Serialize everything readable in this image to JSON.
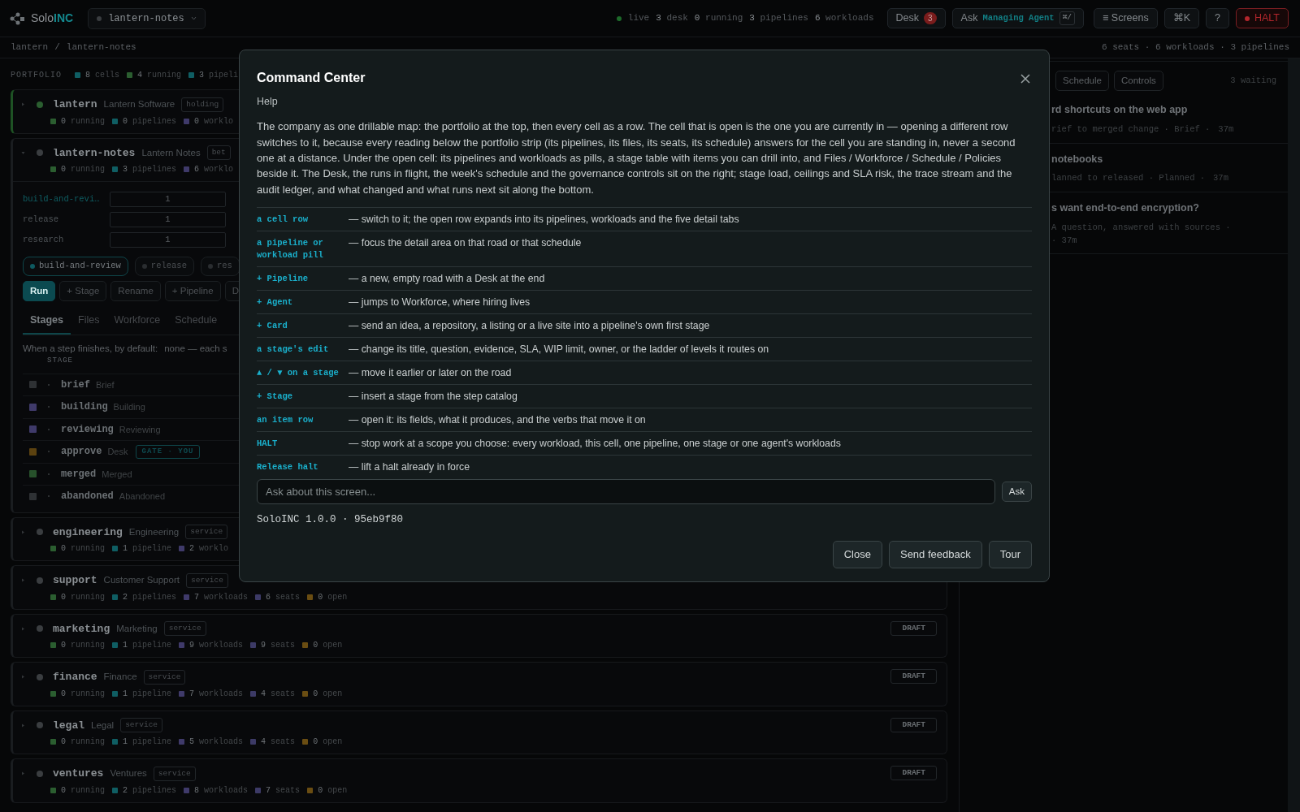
{
  "topbar": {
    "brand": {
      "name": "Solo",
      "accent": "INC"
    },
    "cell_picker": "lantern-notes",
    "live": "live",
    "counts": [
      {
        "count": "3",
        "label": "desk"
      },
      {
        "count": "0",
        "label": "running"
      },
      {
        "count": "3",
        "label": "pipelines"
      },
      {
        "count": "6",
        "label": "workloads"
      }
    ],
    "desk": {
      "label": "Desk",
      "badge": "3"
    },
    "ask": {
      "label": "Ask",
      "agent": "Managing Agent",
      "shortcut": "⌘/"
    },
    "screens": {
      "glyph": "≡",
      "label": "Screens"
    },
    "palette": "⌘K",
    "help": "?",
    "halt": "HALT"
  },
  "breadcrumb": {
    "items": [
      "lantern",
      "lantern-notes"
    ],
    "separator": "/",
    "summary": "6 seats · 6 workloads · 3 pipelines"
  },
  "portfolio": {
    "label": "PORTFOLIO",
    "stats": [
      {
        "count": "8",
        "label": "cells",
        "color": "#0f5e63"
      },
      {
        "count": "4",
        "label": "running",
        "color": "#2b5e30"
      },
      {
        "count": "3",
        "label": "pipeli",
        "color": "#0f5e63"
      }
    ]
  },
  "cells": [
    {
      "name": "lantern",
      "title": "Lantern Software",
      "tag": "holding",
      "color": "#2b5e30",
      "selected": true,
      "expanded": false,
      "stats": [
        {
          "count": "0",
          "label": "running",
          "color": "#2b5e30"
        },
        {
          "count": "0",
          "label": "pipelines",
          "color": "#0f5e63"
        },
        {
          "count": "0",
          "label": "worklo",
          "color": "#3f3a6a"
        }
      ]
    },
    {
      "name": "lantern-notes",
      "title": "Lantern Notes",
      "tag": "bet",
      "color": "#3a3d40",
      "selected": false,
      "expanded": true,
      "stats": [
        {
          "count": "0",
          "label": "running",
          "color": "#2b5e30"
        },
        {
          "count": "3",
          "label": "pipelines",
          "color": "#0f5e63"
        },
        {
          "count": "6",
          "label": "worklo",
          "color": "#3f3a6a"
        }
      ]
    },
    {
      "name": "engineering",
      "title": "Engineering",
      "tag": "service",
      "color": "#3a3d40",
      "selected": false,
      "expanded": false,
      "stats": [
        {
          "count": "0",
          "label": "running",
          "color": "#2b5e30"
        },
        {
          "count": "1",
          "label": "pipeline",
          "color": "#0f5e63"
        },
        {
          "count": "2",
          "label": "worklo",
          "color": "#3f3a6a"
        }
      ]
    },
    {
      "name": "support",
      "title": "Customer Support",
      "tag": "service",
      "color": "#3a3d40",
      "selected": false,
      "expanded": false,
      "stats": [
        {
          "count": "0",
          "label": "running",
          "color": "#2b5e30"
        },
        {
          "count": "2",
          "label": "pipelines",
          "color": "#0f5e63"
        },
        {
          "count": "7",
          "label": "workloads",
          "color": "#3f3a6a"
        },
        {
          "count": "6",
          "label": "seats",
          "color": "#3c3a66"
        },
        {
          "count": "0",
          "label": "open",
          "color": "#6a4d12"
        }
      ]
    },
    {
      "name": "marketing",
      "title": "Marketing",
      "tag": "service",
      "color": "#3a3d40",
      "selected": false,
      "expanded": false,
      "draft": "DRAFT",
      "stats": [
        {
          "count": "0",
          "label": "running",
          "color": "#2b5e30"
        },
        {
          "count": "1",
          "label": "pipeline",
          "color": "#0f5e63"
        },
        {
          "count": "9",
          "label": "workloads",
          "color": "#3f3a6a"
        },
        {
          "count": "9",
          "label": "seats",
          "color": "#3c3a66"
        },
        {
          "count": "0",
          "label": "open",
          "color": "#6a4d12"
        }
      ]
    },
    {
      "name": "finance",
      "title": "Finance",
      "tag": "service",
      "color": "#3a3d40",
      "selected": false,
      "expanded": false,
      "draft": "DRAFT",
      "stats": [
        {
          "count": "0",
          "label": "running",
          "color": "#2b5e30"
        },
        {
          "count": "1",
          "label": "pipeline",
          "color": "#0f5e63"
        },
        {
          "count": "7",
          "label": "workloads",
          "color": "#3f3a6a"
        },
        {
          "count": "4",
          "label": "seats",
          "color": "#3c3a66"
        },
        {
          "count": "0",
          "label": "open",
          "color": "#6a4d12"
        }
      ]
    },
    {
      "name": "legal",
      "title": "Legal",
      "tag": "service",
      "color": "#3a3d40",
      "selected": false,
      "expanded": false,
      "draft": "DRAFT",
      "stats": [
        {
          "count": "0",
          "label": "running",
          "color": "#2b5e30"
        },
        {
          "count": "1",
          "label": "pipeline",
          "color": "#0f5e63"
        },
        {
          "count": "5",
          "label": "workloads",
          "color": "#3f3a6a"
        },
        {
          "count": "4",
          "label": "seats",
          "color": "#3c3a66"
        },
        {
          "count": "0",
          "label": "open",
          "color": "#6a4d12"
        }
      ]
    },
    {
      "name": "ventures",
      "title": "Ventures",
      "tag": "service",
      "color": "#3a3d40",
      "selected": false,
      "expanded": false,
      "draft": "DRAFT",
      "stats": [
        {
          "count": "0",
          "label": "running",
          "color": "#2b5e30"
        },
        {
          "count": "2",
          "label": "pipelines",
          "color": "#0f5e63"
        },
        {
          "count": "8",
          "label": "workloads",
          "color": "#3f3a6a"
        },
        {
          "count": "7",
          "label": "seats",
          "color": "#3c3a66"
        },
        {
          "count": "0",
          "label": "open",
          "color": "#6a4d12"
        }
      ]
    }
  ],
  "open_cell": {
    "pipelines": [
      {
        "name": "build-and-revi…",
        "value": "1",
        "selected": true
      },
      {
        "name": "release",
        "value": "1",
        "selected": false
      },
      {
        "name": "research",
        "value": "1",
        "selected": false
      }
    ],
    "pills": [
      {
        "label": "build-and-review",
        "selected": true
      },
      {
        "label": "release",
        "selected": false
      },
      {
        "label": "res",
        "selected": false
      }
    ],
    "actions": [
      {
        "label": "Run",
        "kind": "primary"
      },
      {
        "label": "+ Stage",
        "kind": "outline"
      },
      {
        "label": "Rename",
        "kind": "outline"
      },
      {
        "label": "+ Pipeline",
        "kind": "outline"
      },
      {
        "label": "D",
        "kind": "outline"
      }
    ],
    "tabs": [
      {
        "label": "Stages",
        "selected": true
      },
      {
        "label": "Files",
        "selected": false
      },
      {
        "label": "Workforce",
        "selected": false
      },
      {
        "label": "Schedule",
        "selected": false
      }
    ],
    "note": {
      "label": "When a step finishes, by default:",
      "value": "none — each s"
    },
    "stage_header": "STAGE",
    "stages": [
      {
        "name": "brief",
        "label": "Brief",
        "color": "#2e3134"
      },
      {
        "name": "building",
        "label": "Building",
        "color": "#3f3a6a"
      },
      {
        "name": "reviewing",
        "label": "Reviewing",
        "color": "#3f3a6a"
      },
      {
        "name": "approve",
        "label": "Desk",
        "color": "#5c4210",
        "badge": "GATE · YOU"
      },
      {
        "name": "merged",
        "label": "Merged",
        "color": "#27512b"
      },
      {
        "name": "abandoned",
        "label": "Abandoned",
        "color": "#2e3134"
      }
    ]
  },
  "side": {
    "tabs": [
      {
        "label": "Schedule",
        "selected": false
      },
      {
        "label": "Controls",
        "selected": false
      }
    ],
    "waiting": "3 waiting",
    "items": [
      {
        "title": "rd shortcuts on the web app",
        "meta": "rief to merged change · Brief ·",
        "time": "37m"
      },
      {
        "title": "notebooks",
        "meta": "lanned to released · Planned ·",
        "time": "37m"
      },
      {
        "title": "s want end-to-end encryption?",
        "meta": "A question, answered with sources ·",
        "time": "· 37m"
      }
    ]
  },
  "modal": {
    "title": "Command Center",
    "subtitle": "Help",
    "intro": "The company as one drillable map: the portfolio at the top, then every cell as a row. The cell that is open is the one you are currently in — opening a different row switches to it, because every reading below the portfolio strip (its pipelines, its files, its seats, its schedule) answers for the cell you are standing in, never a second one at a distance. Under the open cell: its pipelines and workloads as pills, a stage table with items you can drill into, and Files / Workforce / Schedule / Policies beside it. The Desk, the runs in flight, the week's schedule and the governance controls sit on the right; stage load, ceilings and SLA risk, the trace stream and the audit ledger, and what changed and what runs next sit along the bottom.",
    "rows": [
      {
        "key": "a cell row",
        "text": "— switch to it; the open row expands into its pipelines, workloads and the five detail tabs"
      },
      {
        "key": "a pipeline or workload pill",
        "text": "— focus the detail area on that road or that schedule"
      },
      {
        "key": "+ Pipeline",
        "text": "— a new, empty road with a Desk at the end"
      },
      {
        "key": "+ Agent",
        "text": "— jumps to Workforce, where hiring lives"
      },
      {
        "key": "+ Card",
        "text": "— send an idea, a repository, a listing or a live site into a pipeline's own first stage"
      },
      {
        "key": "a stage's edit",
        "text": "— change its title, question, evidence, SLA, WIP limit, owner, or the ladder of levels it routes on"
      },
      {
        "key": "▲ / ▼ on a stage",
        "text": "— move it earlier or later on the road"
      },
      {
        "key": "+ Stage",
        "text": "— insert a stage from the step catalog"
      },
      {
        "key": "an item row",
        "text": "— open it: its fields, what it produces, and the verbs that move it on"
      },
      {
        "key": "HALT",
        "text": "— stop work at a scope you choose: every workload, this cell, one pipeline, one stage or one agent's workloads"
      },
      {
        "key": "Release halt",
        "text": "— lift a halt already in force"
      }
    ],
    "ask": {
      "placeholder": "Ask about this screen...",
      "button": "Ask"
    },
    "version": "SoloINC 1.0.0 · 95eb9f80",
    "buttons": [
      "Close",
      "Send feedback",
      "Tour"
    ]
  }
}
